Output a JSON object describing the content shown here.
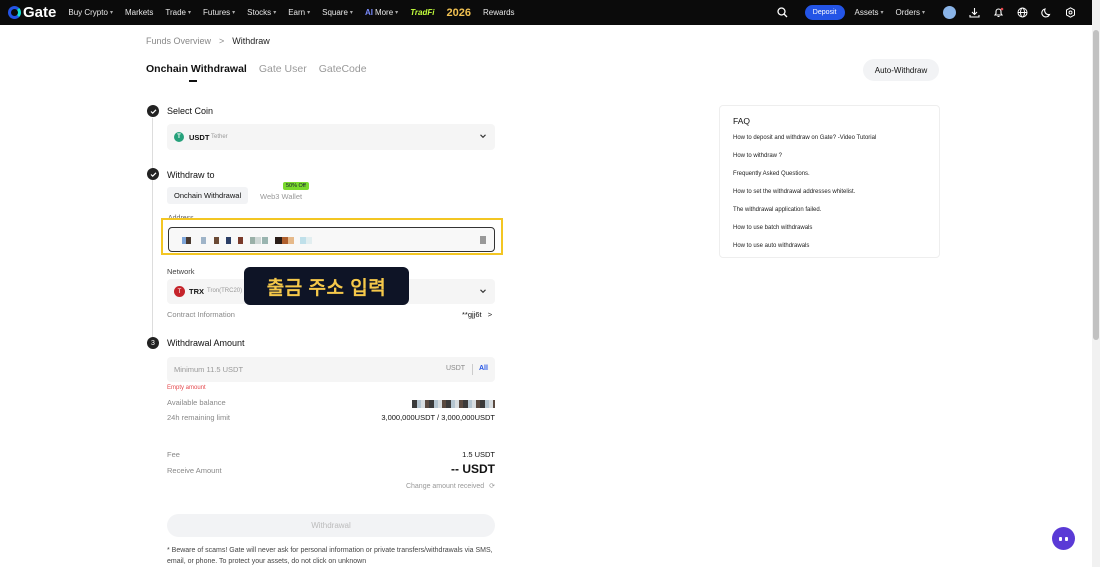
{
  "nav": {
    "logo": "Gate",
    "items": [
      {
        "label": "Buy Crypto",
        "caret": true
      },
      {
        "label": "Markets",
        "caret": false
      },
      {
        "label": "Trade",
        "caret": true
      },
      {
        "label": "Futures",
        "caret": true
      },
      {
        "label": "Stocks",
        "caret": true
      },
      {
        "label": "Earn",
        "caret": true
      },
      {
        "label": "Square",
        "caret": true
      }
    ],
    "ai": "AI",
    "more": "More",
    "tradfi": "TradFi",
    "year": "2026",
    "rewards": "Rewards",
    "deposit": "Deposit",
    "assets": "Assets",
    "orders": "Orders"
  },
  "breadcrumb": {
    "parent": "Funds Overview",
    "sep": ">",
    "current": "Withdraw"
  },
  "tabs": [
    "Onchain Withdrawal",
    "Gate User",
    "GateCode"
  ],
  "auto_withdraw": "Auto-Withdraw",
  "step1": {
    "num": "",
    "title": "Select Coin",
    "coin": "USDT",
    "coin_name": "Tether",
    "coin_icon": "T"
  },
  "step2": {
    "title": "Withdraw to",
    "subtab_active": "Onchain Withdrawal",
    "subtab_other": "Web3 Wallet",
    "badge": "50% Off",
    "address_label": "Address"
  },
  "network": {
    "label": "Network",
    "coin": "TRX",
    "name": "Tron(TRC20)",
    "icon": "T"
  },
  "tooltip": "출금 주소 입력",
  "contract": {
    "label": "Contract Information",
    "value": "**gjj6t",
    "arrow": ">"
  },
  "step3": {
    "num": "3",
    "title": "Withdrawal Amount"
  },
  "amount": {
    "placeholder": "Minimum 11.5 USDT",
    "unit": "USDT",
    "all": "All",
    "error": "Empty amount"
  },
  "balance": {
    "label": "Available balance",
    "limit_label": "24h remaining limit",
    "limit_value": "3,000,000USDT / 3,000,000USDT"
  },
  "fee": {
    "label": "Fee",
    "value": "1.5 USDT"
  },
  "receive": {
    "label": "Receive Amount",
    "value": "-- USDT",
    "change": "Change amount received"
  },
  "withdraw_btn": "Withdrawal",
  "warning": "* Beware of scams! Gate will never ask for personal information or private transfers/withdrawals via SMS, email, or phone. To protect your assets, do not click on unknown",
  "faq": {
    "title": "FAQ",
    "items": [
      "How to deposit and withdraw on Gate? -Video Tutorial",
      "How to withdraw ?",
      "Frequently Asked Questions.",
      "How to set the withdrawal addresses whitelist.",
      "The withdrawal application failed.",
      "How to use batch withdrawals",
      "How to use auto withdrawals"
    ]
  },
  "colors": {
    "accent": "#2354e6",
    "highlight": "#f3c623",
    "tooltip_bg": "#0e1426",
    "tooltip_text": "#f5c84a",
    "usdt": "#26a17b",
    "trx": "#c5242b"
  }
}
